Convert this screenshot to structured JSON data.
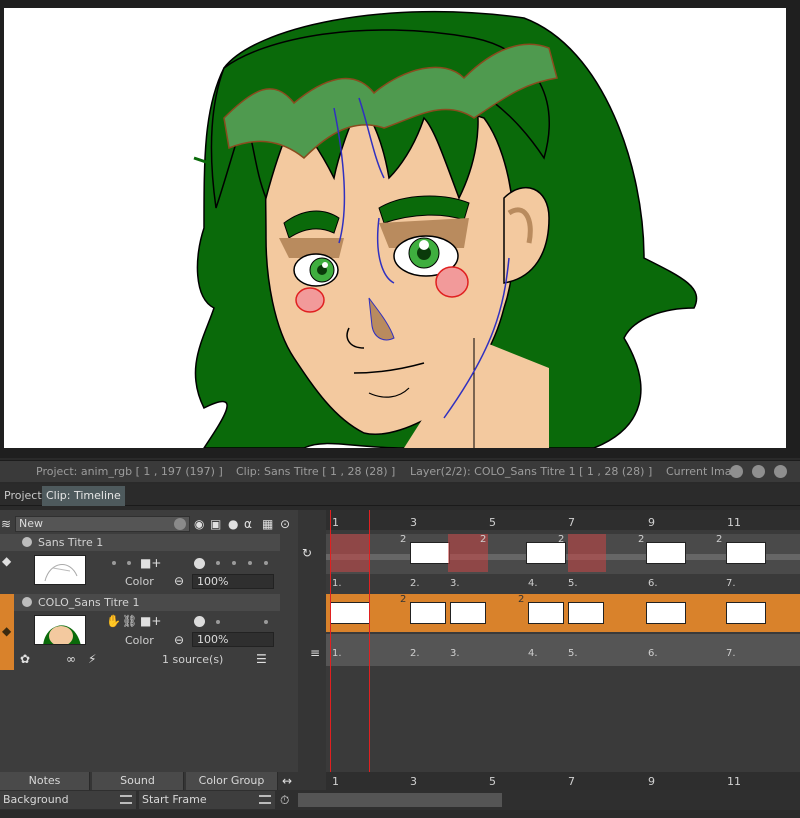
{
  "status": {
    "project": "Project: anim_rgb [ 1 , 197  (197) ]",
    "clip": "Clip: Sans Titre [ 1 , 28  (28) ]",
    "layer": "Layer(2/2): COLO_Sans Titre 1 [ 1 , 28  (28) ]",
    "current": "Current Ima"
  },
  "tabs": [
    "Project",
    "Clip: Timeline"
  ],
  "layer_panel": {
    "new_label": "New",
    "layers": [
      {
        "name": "Sans Titre 1",
        "color_label": "Color",
        "opacity": "100%"
      },
      {
        "name": "COLO_Sans Titre 1",
        "color_label": "Color",
        "opacity": "100%",
        "sources": "1 source(s)"
      }
    ]
  },
  "ruler": [
    "1",
    "3",
    "5",
    "7",
    "9",
    "11"
  ],
  "track_labels": [
    "1.",
    "2.",
    "3.",
    "4.",
    "5.",
    "6.",
    "7."
  ],
  "frame_markers": [
    "2",
    "2",
    "2",
    "2",
    "2",
    "2",
    "2"
  ],
  "bottom": {
    "notes": "Notes",
    "sound": "Sound",
    "color_group": "Color Group",
    "background": "Background",
    "start_frame": "Start Frame"
  },
  "colors": {
    "accent": "#d9822b",
    "hair": "#0a6a0a",
    "skin": "#f3c99f",
    "tab_active": "#4e5a5d"
  }
}
